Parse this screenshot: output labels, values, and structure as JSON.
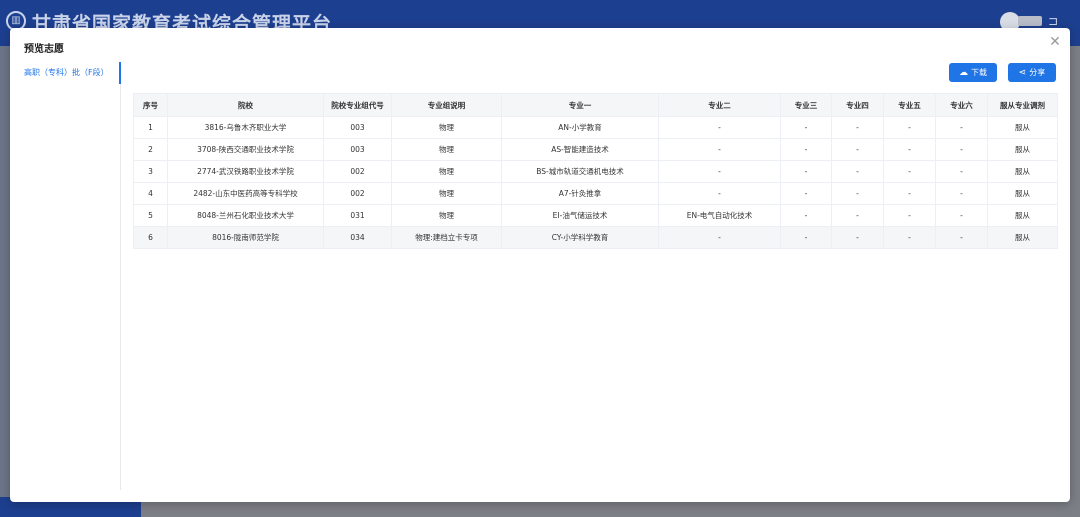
{
  "app": {
    "title": "甘肃省国家教育考试综合管理平台",
    "logo_glyph": "▥",
    "exit_glyph": "⊐"
  },
  "dialog": {
    "title": "预览志愿",
    "close_glyph": "✕",
    "tabs": [
      {
        "label": "高职（专科）批（F段）",
        "active": true
      }
    ],
    "buttons": {
      "download": {
        "label": "下载",
        "icon": "cloud-download-icon",
        "glyph": "☁"
      },
      "share": {
        "label": "分享",
        "icon": "share-icon",
        "glyph": "⋖"
      }
    }
  },
  "table": {
    "headers": [
      "序号",
      "院校",
      "院校专业组代号",
      "专业组说明",
      "专业一",
      "专业二",
      "专业三",
      "专业四",
      "专业五",
      "专业六",
      "服从专业调剂"
    ],
    "rows": [
      [
        "1",
        "3816-乌鲁木齐职业大学",
        "003",
        "物理",
        "AN-小学教育",
        "-",
        "-",
        "-",
        "-",
        "-",
        "服从"
      ],
      [
        "2",
        "3708-陕西交通职业技术学院",
        "003",
        "物理",
        "AS-智能建造技术",
        "-",
        "-",
        "-",
        "-",
        "-",
        "服从"
      ],
      [
        "3",
        "2774-武汉铁路职业技术学院",
        "002",
        "物理",
        "BS-城市轨道交通机电技术",
        "-",
        "-",
        "-",
        "-",
        "-",
        "服从"
      ],
      [
        "4",
        "2482-山东中医药高等专科学校",
        "002",
        "物理",
        "A7-针灸推拿",
        "-",
        "-",
        "-",
        "-",
        "-",
        "服从"
      ],
      [
        "5",
        "8048-兰州石化职业技术大学",
        "031",
        "物理",
        "EI-油气储运技术",
        "EN-电气自动化技术",
        "-",
        "-",
        "-",
        "-",
        "服从"
      ],
      [
        "6",
        "8016-陇南师范学院",
        "034",
        "物理:建档立卡专项",
        "CY-小学科学教育",
        "-",
        "-",
        "-",
        "-",
        "-",
        "服从"
      ]
    ]
  },
  "colors": {
    "accent": "#1f74e6",
    "header_bg": "#1d3f8f",
    "table_header_bg": "#f5f6f8"
  }
}
